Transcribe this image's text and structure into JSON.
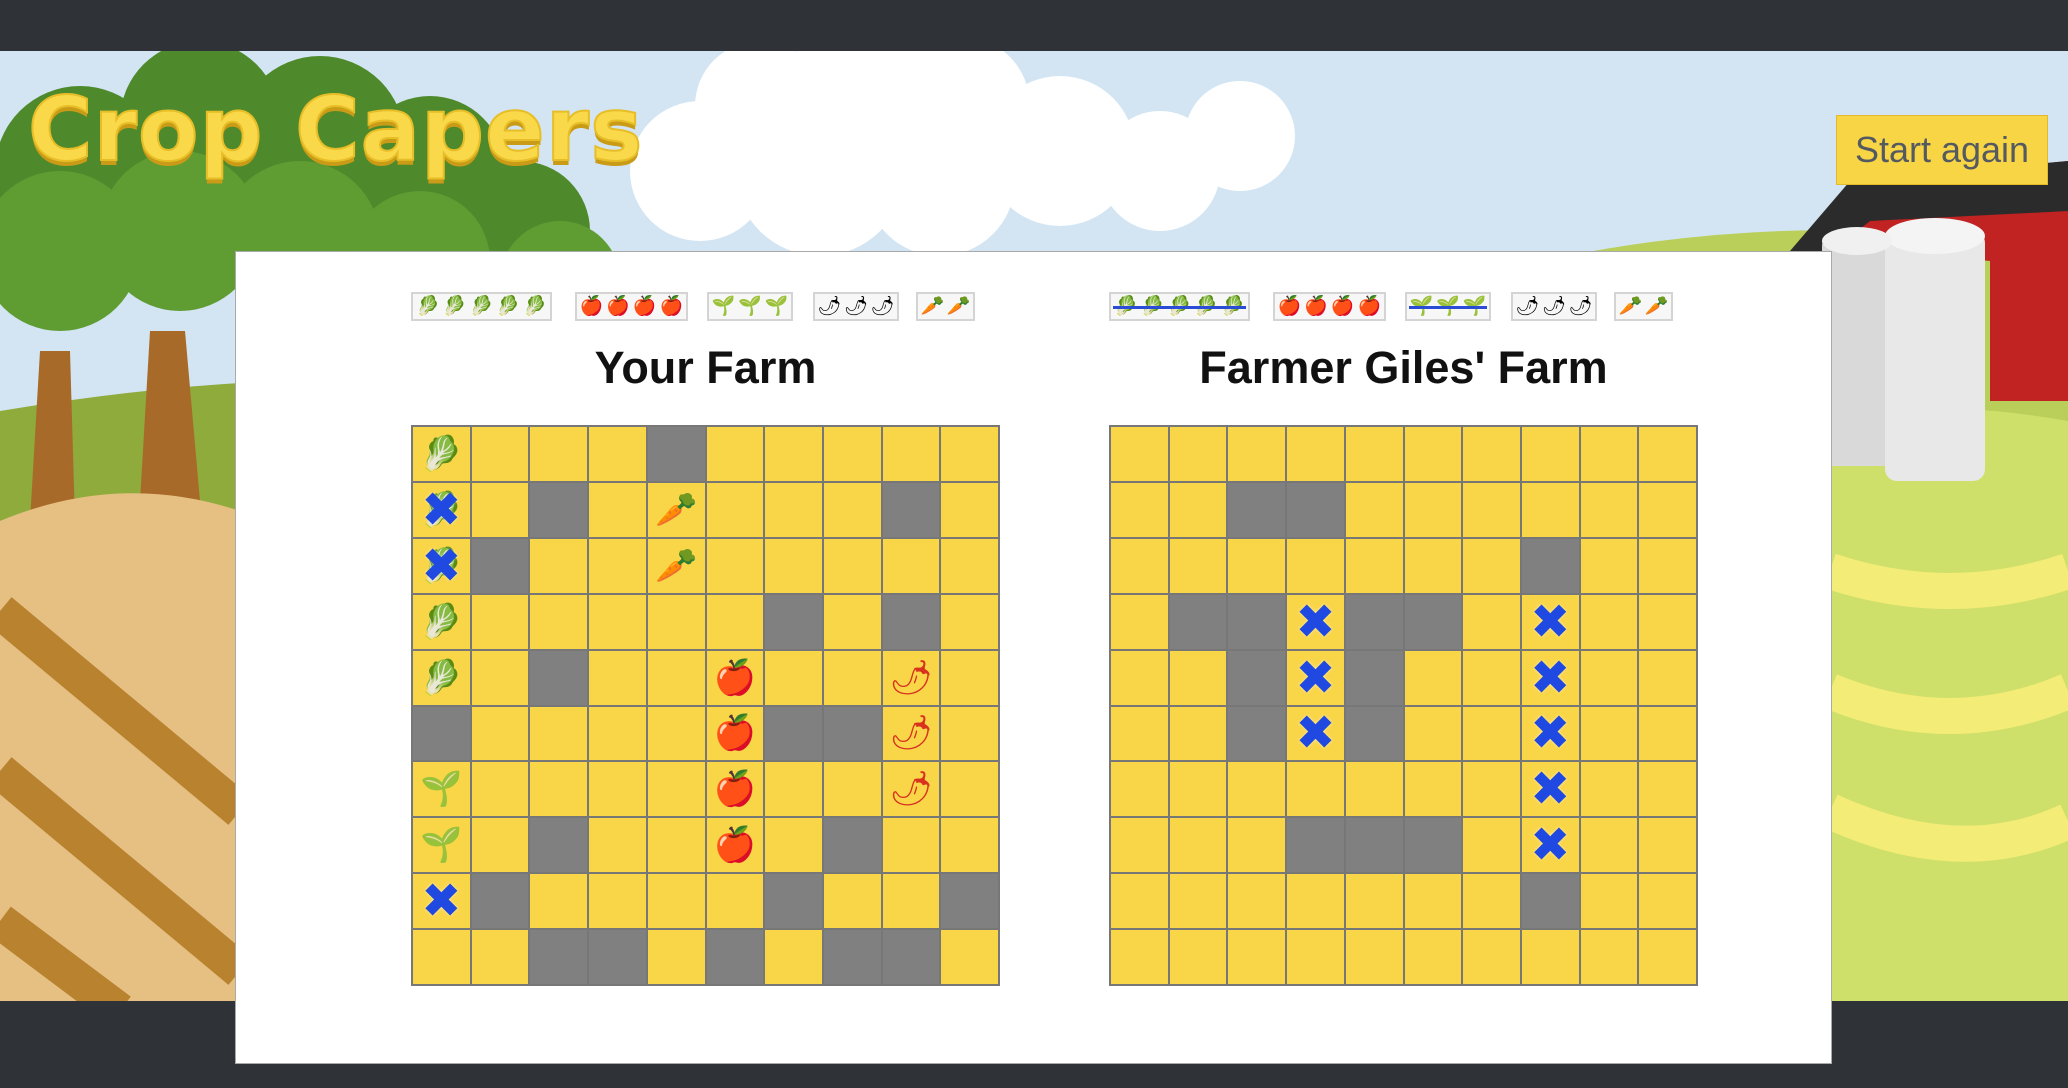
{
  "game": {
    "title": "Crop Capers",
    "start_again_label": "Start again"
  },
  "crops": {
    "lettuce": "🥬",
    "apple": "🍎",
    "sprout": "🌱",
    "pepper": "🌶",
    "carrot": "🥕"
  },
  "colors": {
    "field_empty": "#f9d548",
    "field_miss": "#808080",
    "hit_marker": "#1f49e0",
    "accent": "#f8d545",
    "frame": "#2f3337"
  },
  "player": {
    "title": "Your Farm",
    "fleet": [
      {
        "crop": "lettuce",
        "count": 5,
        "sunk": false
      },
      {
        "crop": "apple",
        "count": 4,
        "sunk": false
      },
      {
        "crop": "sprout",
        "count": 3,
        "sunk": false
      },
      {
        "crop": "pepper",
        "count": 3,
        "sunk": false
      },
      {
        "crop": "carrot",
        "count": 2,
        "sunk": false
      }
    ],
    "grid": [
      [
        "L",
        "",
        "",
        "",
        "M",
        "",
        "",
        "",
        "",
        ""
      ],
      [
        "LX",
        "",
        "M",
        "",
        "C",
        "",
        "",
        "",
        "M",
        ""
      ],
      [
        "LX",
        "M",
        "",
        "",
        "C",
        "",
        "",
        "",
        "",
        ""
      ],
      [
        "L",
        "",
        "",
        "",
        "",
        "",
        "M",
        "",
        "M",
        ""
      ],
      [
        "L",
        "",
        "M",
        "",
        "",
        "A",
        "",
        "",
        "P",
        ""
      ],
      [
        "M",
        "",
        "",
        "",
        "",
        "A",
        "M",
        "M",
        "P",
        ""
      ],
      [
        "S",
        "",
        "",
        "",
        "",
        "A",
        "",
        "",
        "P",
        ""
      ],
      [
        "S",
        "",
        "M",
        "",
        "",
        "A",
        "",
        "M",
        "",
        ""
      ],
      [
        "X",
        "M",
        "",
        "",
        "",
        "",
        "M",
        "",
        "",
        "M"
      ],
      [
        "",
        "",
        "M",
        "M",
        "",
        "M",
        "",
        "M",
        "M",
        ""
      ]
    ]
  },
  "opponent": {
    "title": "Farmer Giles' Farm",
    "fleet": [
      {
        "crop": "lettuce",
        "count": 5,
        "sunk": true
      },
      {
        "crop": "apple",
        "count": 4,
        "sunk": false
      },
      {
        "crop": "sprout",
        "count": 3,
        "sunk": true
      },
      {
        "crop": "pepper",
        "count": 3,
        "sunk": false
      },
      {
        "crop": "carrot",
        "count": 2,
        "sunk": false
      }
    ],
    "grid": [
      [
        "",
        "",
        "",
        "",
        "",
        "",
        "",
        "",
        "",
        ""
      ],
      [
        "",
        "",
        "M",
        "M",
        "",
        "",
        "",
        "",
        "",
        ""
      ],
      [
        "",
        "",
        "",
        "",
        "",
        "",
        "",
        "M",
        "",
        ""
      ],
      [
        "",
        "M",
        "M",
        "H",
        "M",
        "M",
        "",
        "H",
        "",
        ""
      ],
      [
        "",
        "",
        "M",
        "H",
        "M",
        "",
        "",
        "H",
        "",
        ""
      ],
      [
        "",
        "",
        "M",
        "H",
        "M",
        "",
        "",
        "H",
        "",
        ""
      ],
      [
        "",
        "",
        "",
        "",
        "",
        "",
        "",
        "H",
        "",
        ""
      ],
      [
        "",
        "",
        "",
        "M",
        "M",
        "M",
        "",
        "H",
        "",
        ""
      ],
      [
        "",
        "",
        "",
        "",
        "",
        "",
        "",
        "M",
        "",
        ""
      ],
      [
        "",
        "",
        "",
        "",
        "",
        "",
        "",
        "",
        "",
        ""
      ]
    ]
  }
}
